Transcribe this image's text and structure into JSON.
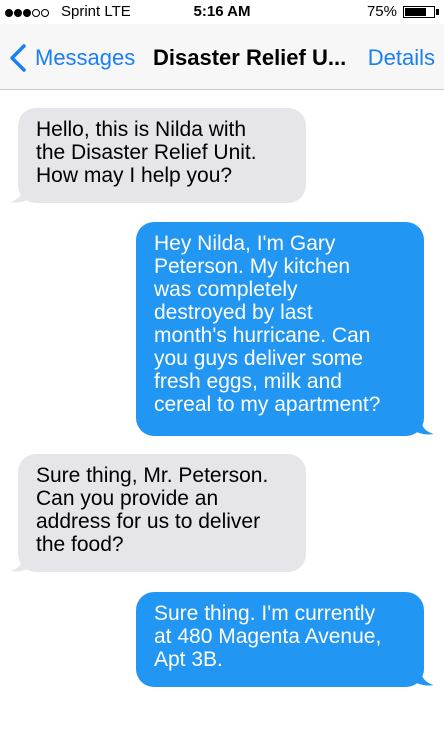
{
  "status_bar": {
    "carrier": "Sprint  LTE",
    "time": "5:16 AM",
    "battery": "75%",
    "battery_level": 0.75,
    "signal_bars": 3,
    "signal_icon": "signal-dots-icon",
    "battery_icon": "battery-icon"
  },
  "nav": {
    "back_label": "Messages",
    "back_icon": "chevron-left-icon",
    "title": "Disaster Relief U...",
    "details_label": "Details",
    "accent_color": "#1a7ef5"
  },
  "messages": [
    {
      "direction": "incoming",
      "lines": [
        "Hello, this is Nilda with",
        "the Disaster Relief Unit.",
        "How may I help you?"
      ]
    },
    {
      "direction": "outgoing",
      "lines": [
        "Hey Nilda, I'm Gary",
        "Peterson. My kitchen",
        "was completely",
        "destroyed by last",
        "month's hurricane. Can",
        "you guys deliver some",
        "fresh eggs, milk and",
        "cereal to my apartment?"
      ]
    },
    {
      "direction": "incoming",
      "lines": [
        "Sure thing, Mr. Peterson.",
        "Can you provide an",
        "address for us to deliver",
        "the food?"
      ]
    },
    {
      "direction": "outgoing",
      "lines": [
        "Sure thing. I'm currently",
        "at 480 Magenta Avenue,",
        "Apt 3B."
      ]
    }
  ],
  "colors": {
    "incoming_bubble": "#e5e5ea",
    "outgoing_bubble": "#2196f3"
  }
}
